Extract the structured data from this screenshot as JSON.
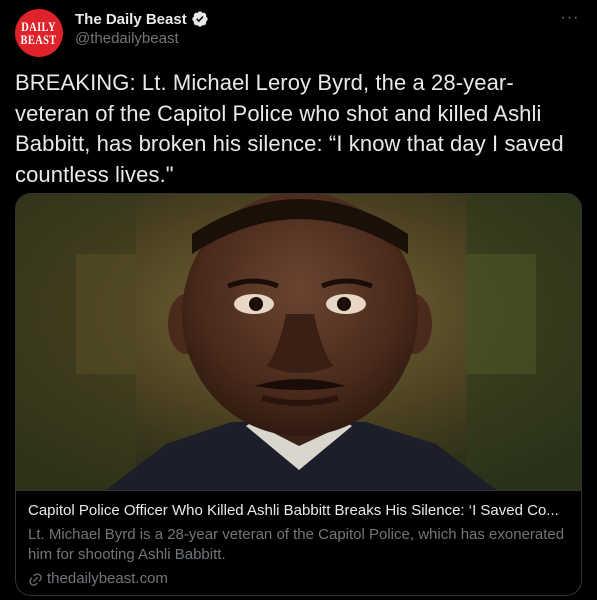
{
  "account": {
    "display_name": "The Daily Beast",
    "handle": "@thedailybeast",
    "logo_line1": "DAILY",
    "logo_line2": "BEAST",
    "more_label": "···"
  },
  "tweet": {
    "text": "BREAKING: Lt. Michael Leroy Byrd, the a 28-year-veteran of the Capitol Police who shot and killed Ashli Babbitt, has broken his silence: “I know that day I saved countless lives.\""
  },
  "card": {
    "title": "Capitol Police Officer Who Killed Ashli Babbitt Breaks His Silence: ‘I Saved Co...",
    "description": "Lt. Michael Byrd is a 28-year veteran of the Capitol Police, which has exonerated him for shooting Ashli Babbitt.",
    "domain": "thedailybeast.com"
  },
  "colors": {
    "background": "#000000",
    "text_primary": "#e7e9ea",
    "text_secondary": "#71767b",
    "border": "#2f3336",
    "verified_blue": "#1d9bf0",
    "logo_red": "#e0222a"
  }
}
